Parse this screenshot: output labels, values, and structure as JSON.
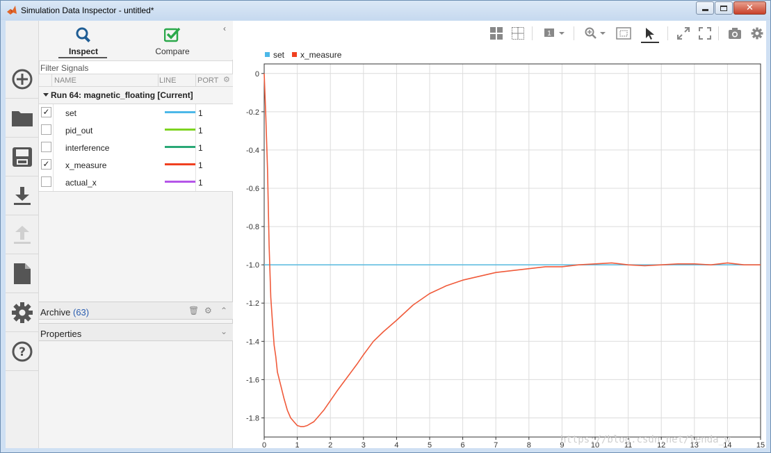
{
  "window": {
    "title": "Simulation Data Inspector - untitled*",
    "colors": {
      "titlebar": "#cfe0f3",
      "accent": "#2a5db0"
    }
  },
  "rail": {
    "items": [
      {
        "icon": "add-icon"
      },
      {
        "icon": "folder-icon"
      },
      {
        "icon": "save-icon"
      },
      {
        "icon": "download-icon"
      },
      {
        "icon": "upload-icon"
      },
      {
        "icon": "document-icon"
      },
      {
        "icon": "gear-icon"
      },
      {
        "icon": "help-icon"
      }
    ]
  },
  "tabs": {
    "inspect": "Inspect",
    "compare": "Compare"
  },
  "signals": {
    "filter_placeholder": "Filter Signals",
    "columns": {
      "name": "NAME",
      "line": "LINE",
      "port": "PORT"
    },
    "run_label": "Run 64: magnetic_floating [Current]",
    "rows": [
      {
        "name": "set",
        "checked": true,
        "color": "#4cb8e8",
        "port": "1"
      },
      {
        "name": "pid_out",
        "checked": false,
        "color": "#7ed321",
        "port": "1"
      },
      {
        "name": "interference",
        "checked": false,
        "color": "#2aa876",
        "port": "1"
      },
      {
        "name": "x_measure",
        "checked": true,
        "color": "#f04020",
        "port": "1"
      },
      {
        "name": "actual_x",
        "checked": false,
        "color": "#b455e8",
        "port": "1"
      }
    ]
  },
  "archive": {
    "label": "Archive",
    "count": "(63)"
  },
  "properties": {
    "label": "Properties"
  },
  "toolbar": {
    "icons": [
      "layout-grid-icon",
      "subplot-icon",
      "cursor-count-icon",
      "zoom-in-icon",
      "fit-to-view-icon",
      "select-cursor-icon",
      "expand-icon",
      "fullscreen-icon",
      "snapshot-camera-icon",
      "settings-gear-icon"
    ],
    "cursor_count": "1"
  },
  "watermark": "https://blog.csdn.net/lenda_w",
  "chart_data": {
    "type": "line",
    "title": "",
    "xlabel": "",
    "ylabel": "",
    "xlim": [
      0,
      15
    ],
    "ylim": [
      -1.9,
      0.05
    ],
    "x_ticks": [
      "0",
      "1",
      "2",
      "3",
      "4",
      "5",
      "6",
      "7",
      "8",
      "9",
      "10",
      "11",
      "12",
      "13",
      "14",
      "15"
    ],
    "y_ticks": [
      "0",
      "-0.2",
      "-0.4",
      "-0.6",
      "-0.8",
      "-1.0",
      "-1.2",
      "-1.4",
      "-1.6",
      "-1.8"
    ],
    "grid": true,
    "legend_position": "top-left",
    "series": [
      {
        "name": "set",
        "color": "#62bde0",
        "x": [
          0,
          15
        ],
        "y": [
          -1.0,
          -1.0
        ]
      },
      {
        "name": "x_measure",
        "color": "#f05a3a",
        "x": [
          0,
          0.05,
          0.1,
          0.15,
          0.2,
          0.25,
          0.3,
          0.35,
          0.4,
          0.5,
          0.6,
          0.7,
          0.8,
          0.9,
          1.0,
          1.1,
          1.2,
          1.3,
          1.4,
          1.5,
          1.6,
          1.8,
          2.0,
          2.2,
          2.5,
          2.8,
          3.0,
          3.3,
          3.6,
          4.0,
          4.5,
          5.0,
          5.5,
          6.0,
          6.5,
          7.0,
          7.5,
          8.0,
          8.5,
          9.0,
          9.5,
          10.0,
          10.5,
          11.0,
          11.5,
          12.0,
          12.5,
          13.0,
          13.5,
          14.0,
          14.5,
          15.0
        ],
        "y": [
          0,
          -0.23,
          -0.5,
          -0.9,
          -1.17,
          -1.3,
          -1.42,
          -1.48,
          -1.56,
          -1.63,
          -1.7,
          -1.76,
          -1.8,
          -1.82,
          -1.84,
          -1.845,
          -1.845,
          -1.84,
          -1.83,
          -1.82,
          -1.8,
          -1.76,
          -1.71,
          -1.66,
          -1.59,
          -1.52,
          -1.47,
          -1.4,
          -1.35,
          -1.29,
          -1.21,
          -1.15,
          -1.11,
          -1.08,
          -1.06,
          -1.04,
          -1.03,
          -1.02,
          -1.01,
          -1.01,
          -1.0,
          -0.995,
          -0.99,
          -1.0,
          -1.005,
          -1.0,
          -0.995,
          -0.995,
          -1.0,
          -0.99,
          -1.0,
          -1.0
        ]
      }
    ]
  }
}
